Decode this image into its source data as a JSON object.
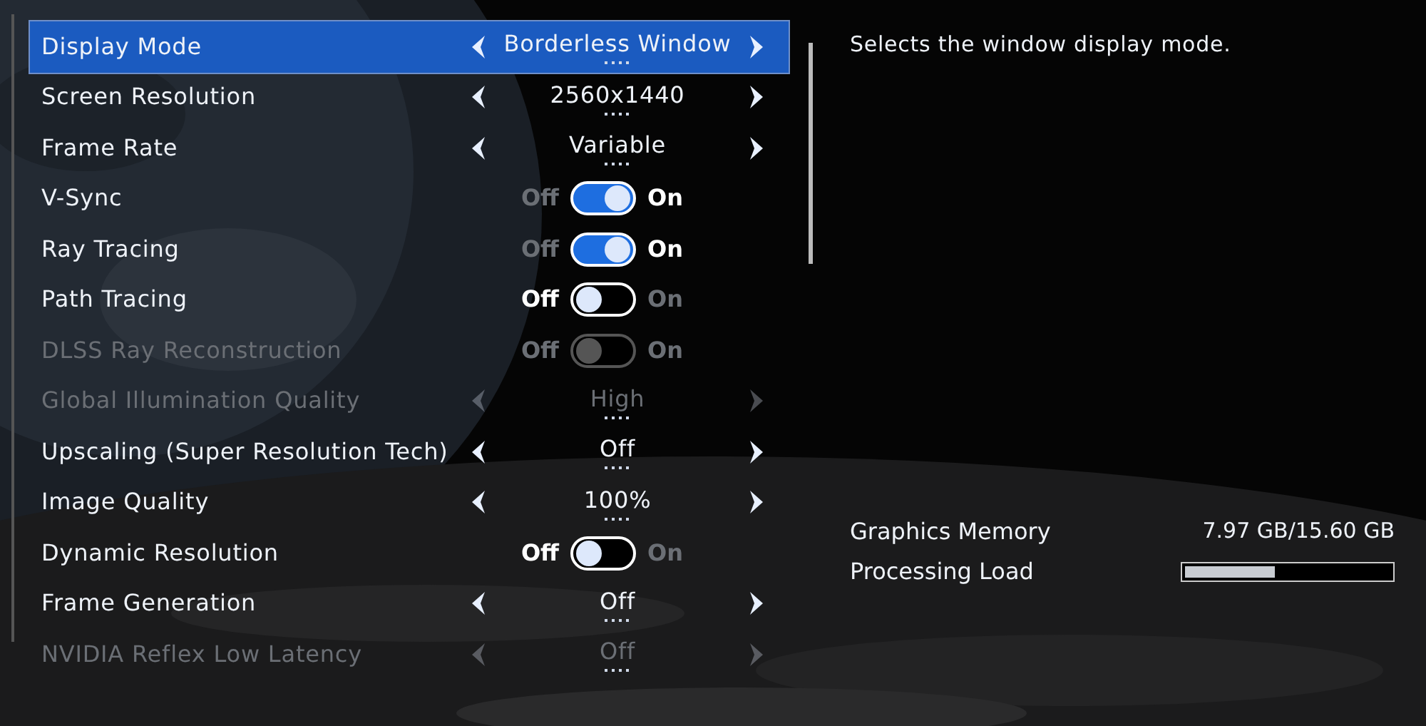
{
  "settings": [
    {
      "kind": "selector",
      "label": "Display Mode",
      "value": "Borderless Window",
      "selected": true,
      "disabled": false
    },
    {
      "kind": "selector",
      "label": "Screen Resolution",
      "value": "2560x1440",
      "selected": false,
      "disabled": false
    },
    {
      "kind": "selector",
      "label": "Frame Rate",
      "value": "Variable",
      "selected": false,
      "disabled": false
    },
    {
      "kind": "toggle",
      "label": "V-Sync",
      "off_label": "Off",
      "on_label": "On",
      "on": true,
      "selected": false,
      "disabled": false
    },
    {
      "kind": "toggle",
      "label": "Ray Tracing",
      "off_label": "Off",
      "on_label": "On",
      "on": true,
      "selected": false,
      "disabled": false
    },
    {
      "kind": "toggle",
      "label": "Path Tracing",
      "off_label": "Off",
      "on_label": "On",
      "on": false,
      "selected": false,
      "disabled": false
    },
    {
      "kind": "toggle",
      "label": "DLSS Ray Reconstruction",
      "off_label": "Off",
      "on_label": "On",
      "on": false,
      "selected": false,
      "disabled": true
    },
    {
      "kind": "selector",
      "label": "Global Illumination Quality",
      "value": "High",
      "selected": false,
      "disabled": true
    },
    {
      "kind": "selector",
      "label": "Upscaling (Super Resolution Tech)",
      "value": "Off",
      "selected": false,
      "disabled": false
    },
    {
      "kind": "selector",
      "label": "Image Quality",
      "value": "100%",
      "selected": false,
      "disabled": false
    },
    {
      "kind": "toggle",
      "label": "Dynamic Resolution",
      "off_label": "Off",
      "on_label": "On",
      "on": false,
      "selected": false,
      "disabled": false
    },
    {
      "kind": "selector",
      "label": "Frame Generation",
      "value": "Off",
      "selected": false,
      "disabled": false
    },
    {
      "kind": "selector",
      "label": "NVIDIA Reflex Low Latency",
      "value": "Off",
      "selected": false,
      "disabled": true
    }
  ],
  "description": "Selects the window display mode.",
  "stats": {
    "memory_label": "Graphics Memory",
    "memory_value": "7.97 GB/15.60 GB",
    "load_label": "Processing Load",
    "level": 0.44
  }
}
